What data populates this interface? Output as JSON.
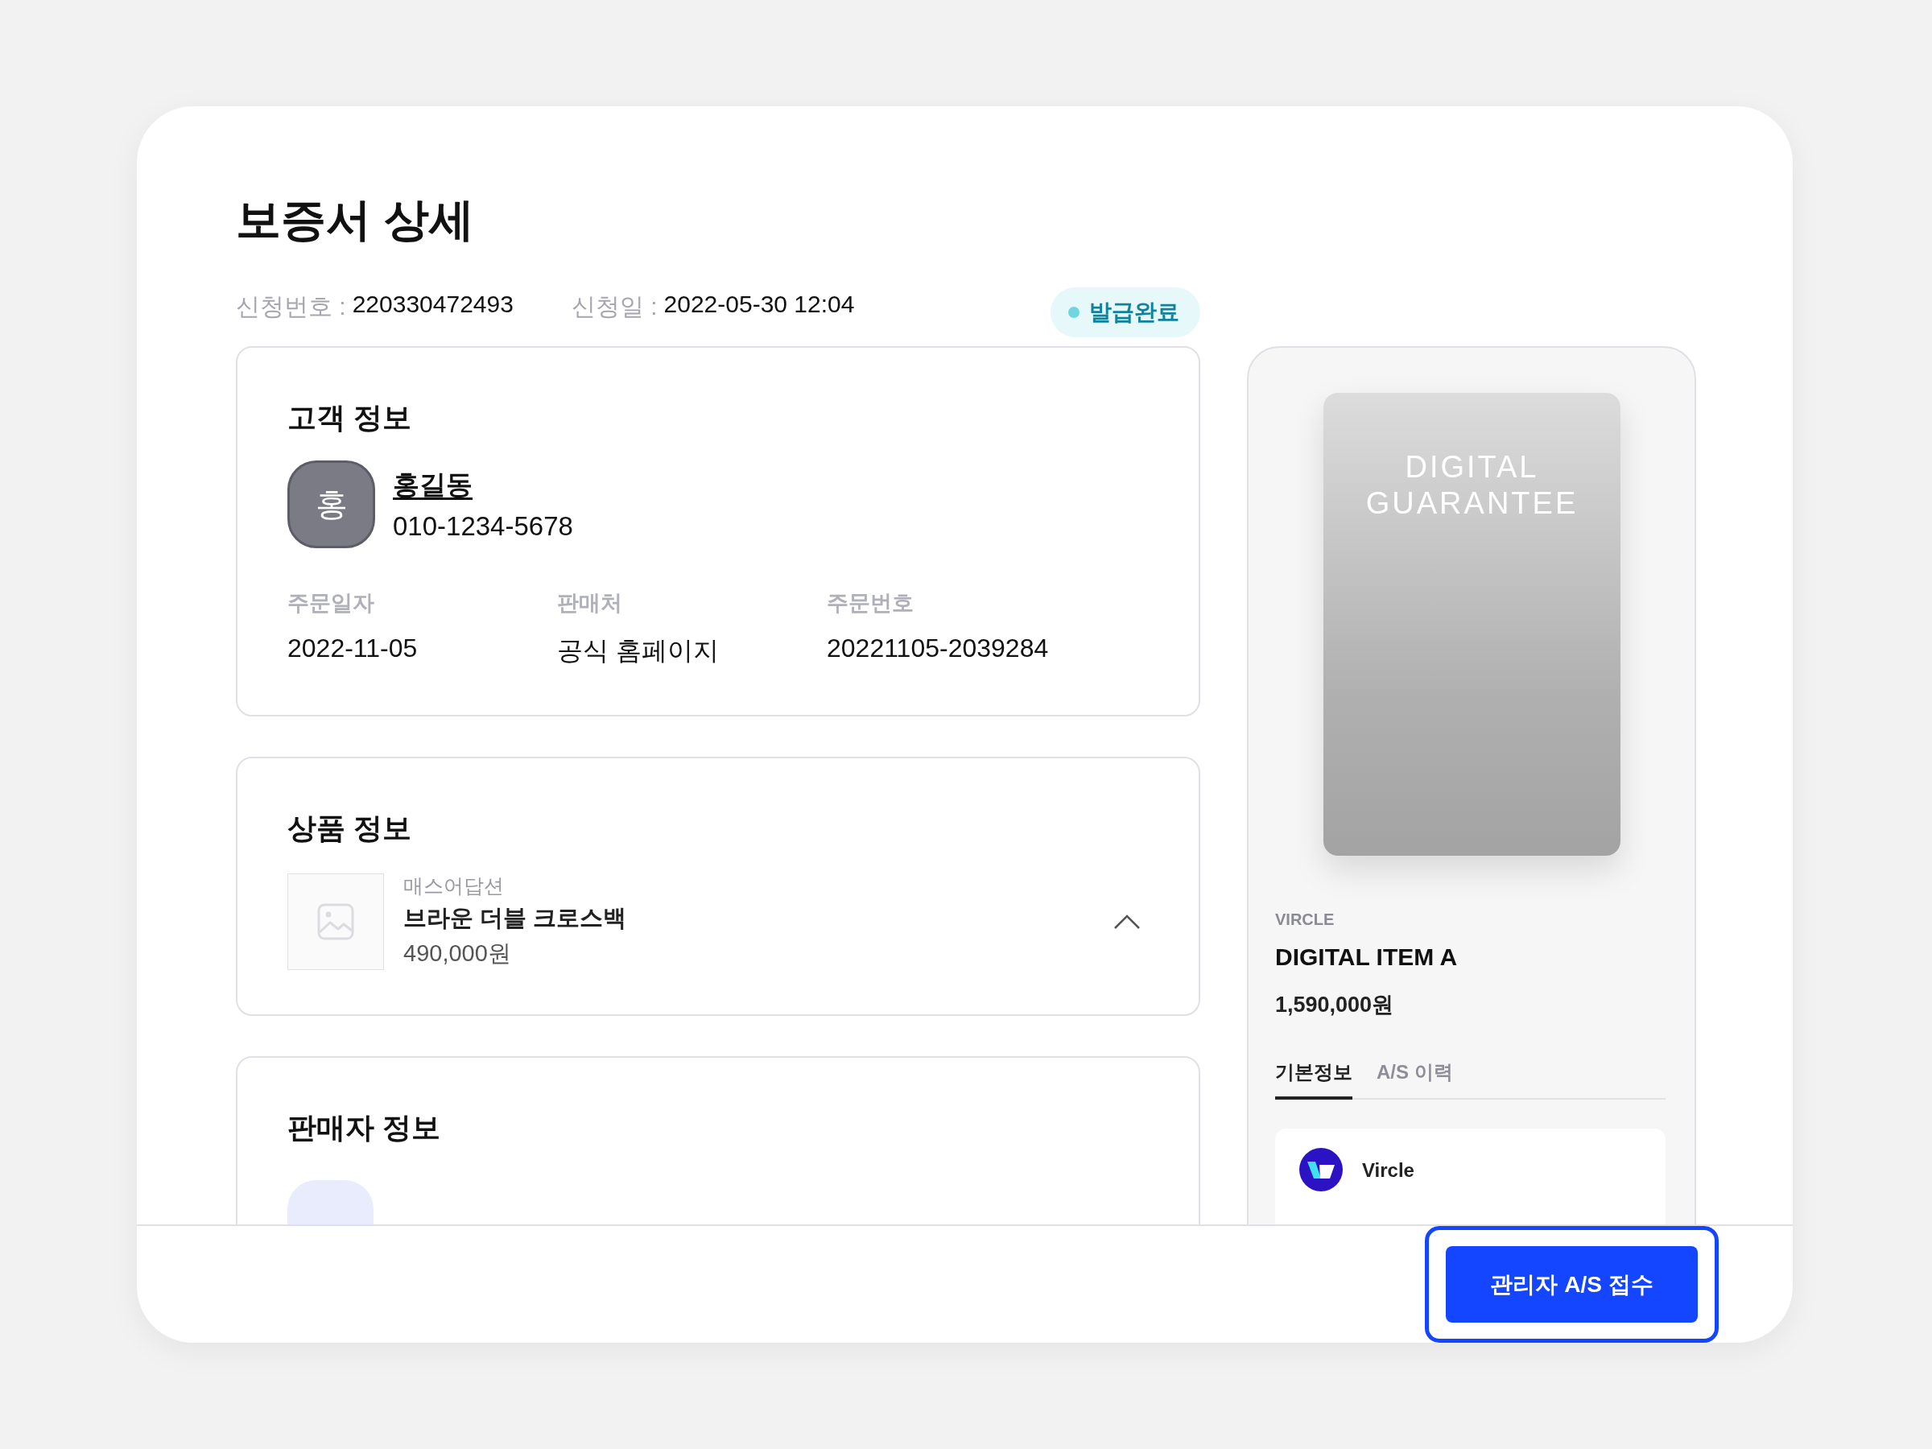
{
  "page": {
    "title": "보증서 상세"
  },
  "meta": [
    {
      "label": "신청번호 :",
      "value": "220330472493"
    },
    {
      "label": "신청일 :",
      "value": "2022-05-30 12:04"
    }
  ],
  "status_badge": {
    "label": "발급완료"
  },
  "customer_info": {
    "title": "고객 정보",
    "avatar_initial": "홍",
    "name": "홍길동",
    "phone": "010-1234-5678",
    "fields": [
      {
        "label": "주문일자",
        "value": "2022-11-05"
      },
      {
        "label": "판매처",
        "value": "공식 홈페이지"
      },
      {
        "label": "주문번호",
        "value": "20221105-2039284"
      }
    ]
  },
  "product_info": {
    "title": "상품 정보",
    "brand": "매스어답션",
    "name": "브라운 더블 크로스백",
    "price": "490,000원",
    "expanded": true
  },
  "seller_info": {
    "title": "판매자 정보"
  },
  "guarantee": {
    "card_text": "DIGITAL GUARANTEE",
    "brand": "VIRCLE",
    "name": "DIGITAL ITEM A",
    "price": "1,590,000원",
    "tabs": [
      {
        "label": "기본정보",
        "selected": true
      },
      {
        "label": "A/S 이력",
        "selected": false
      }
    ],
    "issuer": {
      "name": "Vircle"
    }
  },
  "footer": {
    "button": "관리자 A/S 접수",
    "focused": true
  }
}
